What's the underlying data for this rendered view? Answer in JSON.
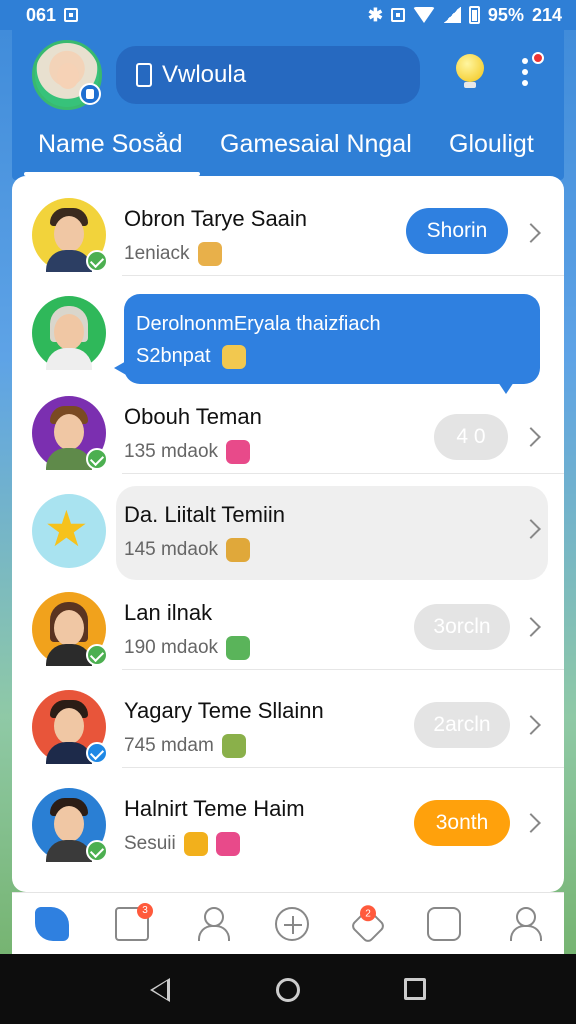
{
  "status_bar": {
    "time": "061",
    "battery": "95%",
    "extra": "214"
  },
  "header": {
    "search_text": "Vwloula",
    "tabs": [
      "Name Sosa̐d",
      "Gamesaial Nngal",
      "Glouligt"
    ]
  },
  "list": [
    {
      "name": "Obron Tarye Saain",
      "subtitle": "1eniack",
      "action": "Shorin",
      "action_style": "blue"
    },
    {
      "bubble_line1": "DerolnonmEryala thaizfiach",
      "bubble_line2": "S2bnpat"
    },
    {
      "name": "Obouh Teman",
      "subtitle": "135 mdaok",
      "action": "4 0",
      "action_style": "gray"
    },
    {
      "name": "Da. Liitalt Temiin",
      "subtitle": "145 mdaok",
      "action": "",
      "action_style": "none"
    },
    {
      "name": "Lan ilnak",
      "subtitle": "190 mdaok",
      "action": "3orcln",
      "action_style": "gray"
    },
    {
      "name": "Yagary Teme Sllainn",
      "subtitle": "745 mdam",
      "action": "2arcln",
      "action_style": "gray"
    },
    {
      "name": "Halnirt Teme Haim",
      "subtitle": "Sesuii",
      "action": "3onth",
      "action_style": "orange"
    }
  ],
  "bottom_nav": {
    "items": [
      "bird-icon",
      "document-icon",
      "profile-icon",
      "add-icon",
      "heart-icon",
      "face-icon",
      "person-icon"
    ],
    "badges": {
      "document": "3",
      "heart": "2"
    }
  },
  "colors": {
    "accent": "#2f80e0",
    "orange": "#ffa10c",
    "header": "#2f7fd6"
  }
}
